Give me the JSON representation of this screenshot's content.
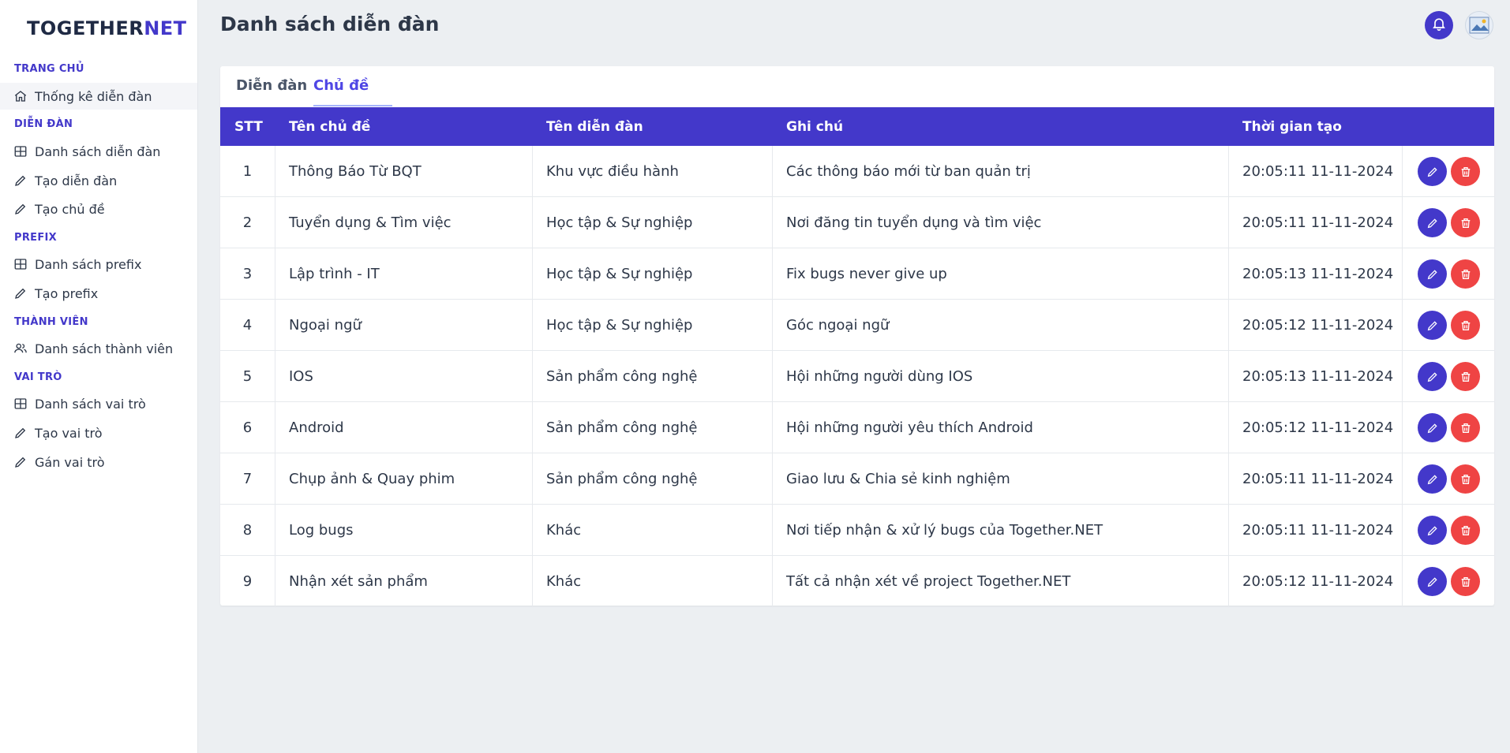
{
  "app": {
    "logo_main": "TOGETHER",
    "logo_accent": "NET"
  },
  "sidebar": {
    "sections": [
      {
        "title": "TRANG CHỦ",
        "items": [
          {
            "label": "Thống kê diễn đàn",
            "icon": "home-icon"
          }
        ]
      },
      {
        "title": "DIỄN ĐÀN",
        "items": [
          {
            "label": "Danh sách diễn đàn",
            "icon": "table-icon"
          },
          {
            "label": "Tạo diễn đàn",
            "icon": "pencil-icon"
          },
          {
            "label": "Tạo chủ đề",
            "icon": "pencil-icon"
          }
        ]
      },
      {
        "title": "PREFIX",
        "items": [
          {
            "label": "Danh sách prefix",
            "icon": "table-icon"
          },
          {
            "label": "Tạo prefix",
            "icon": "pencil-icon"
          }
        ]
      },
      {
        "title": "THÀNH VIÊN",
        "items": [
          {
            "label": "Danh sách thành viên",
            "icon": "users-icon"
          }
        ]
      },
      {
        "title": "VAI TRÒ",
        "items": [
          {
            "label": "Danh sách vai trò",
            "icon": "table-icon"
          },
          {
            "label": "Tạo vai trò",
            "icon": "pencil-icon"
          },
          {
            "label": "Gán vai trò",
            "icon": "pencil-icon"
          }
        ]
      }
    ]
  },
  "header": {
    "title": "Danh sách diễn đàn"
  },
  "tabs": [
    {
      "label": "Diễn đàn",
      "active": false
    },
    {
      "label": "Chủ đề",
      "active": true
    }
  ],
  "table": {
    "columns": [
      "STT",
      "Tên chủ đề",
      "Tên diễn đàn",
      "Ghi chú",
      "Thời gian tạo"
    ],
    "rows": [
      {
        "stt": "1",
        "topic": "Thông Báo Từ BQT",
        "forum": "Khu vực điều hành",
        "note": "Các thông báo mới từ ban quản trị",
        "created": "20:05:11 11-11-2024"
      },
      {
        "stt": "2",
        "topic": "Tuyển dụng & Tìm việc",
        "forum": "Học tập & Sự nghiệp",
        "note": "Nơi đăng tin tuyển dụng và tìm việc",
        "created": "20:05:11 11-11-2024"
      },
      {
        "stt": "3",
        "topic": "Lập trình - IT",
        "forum": "Học tập & Sự nghiệp",
        "note": "Fix bugs never give up",
        "created": "20:05:13 11-11-2024"
      },
      {
        "stt": "4",
        "topic": "Ngoại ngữ",
        "forum": "Học tập & Sự nghiệp",
        "note": "Góc ngoại ngữ",
        "created": "20:05:12 11-11-2024"
      },
      {
        "stt": "5",
        "topic": "IOS",
        "forum": "Sản phẩm công nghệ",
        "note": "Hội những người dùng IOS",
        "created": "20:05:13 11-11-2024"
      },
      {
        "stt": "6",
        "topic": "Android",
        "forum": "Sản phẩm công nghệ",
        "note": "Hội những người yêu thích Android",
        "created": "20:05:12 11-11-2024"
      },
      {
        "stt": "7",
        "topic": "Chụp ảnh & Quay phim",
        "forum": "Sản phẩm công nghệ",
        "note": "Giao lưu & Chia sẻ kinh nghiệm",
        "created": "20:05:11 11-11-2024"
      },
      {
        "stt": "8",
        "topic": "Log bugs",
        "forum": "Khác",
        "note": "Nơi tiếp nhận & xử lý bugs của Together.NET",
        "created": "20:05:11 11-11-2024"
      },
      {
        "stt": "9",
        "topic": "Nhận xét sản phẩm",
        "forum": "Khác",
        "note": "Tất cả nhận xét về project Together.NET",
        "created": "20:05:12 11-11-2024"
      }
    ]
  },
  "colors": {
    "primary": "#4338ca",
    "danger": "#ef4444",
    "background": "#eceff2"
  }
}
